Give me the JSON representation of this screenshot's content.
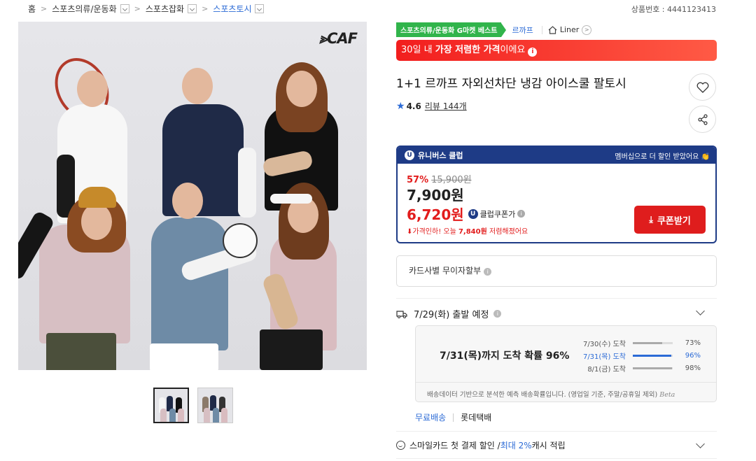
{
  "breadcrumb": {
    "home": "홈",
    "items": [
      "스포츠의류/운동화",
      "스포츠잡화",
      "스포츠토시"
    ]
  },
  "product_no": "상품번호 : 4441123413",
  "hero": {
    "logo_text": "CAF",
    "thumbnail_count": 2
  },
  "badges": {
    "best": "스포츠의류/운동화 G마켓 베스트",
    "brand": "르까프",
    "shop": "Liner"
  },
  "price_alert": {
    "pre": "30일 내 ",
    "bold": "가장 저렴한 가격",
    "post": "이에요"
  },
  "title": "1+1 르까프 자외선차단 냉감 아이스쿨 팔토시",
  "rating": {
    "score": "4.6",
    "reviews": "리뷰 144개"
  },
  "price_box": {
    "header": "유니버스 클럽",
    "header_right": "멤버십으로 더 할인 받았어요",
    "discount": "57%",
    "original": "15,900원",
    "price": "7,900원",
    "club_price": "6,720원",
    "club_label": "클럽쿠폰가",
    "drop_pre": "가격인하! 오늘 ",
    "drop_amount": "7,840원",
    "drop_post": " 저렴해졌어요",
    "coupon_button": "쿠폰받기"
  },
  "installment": "카드사별 무이자할부",
  "shipping": {
    "departure": "7/29(화) 출발 예정",
    "probability_text": "7/31(목)까지 도착 확률 96%",
    "rows": [
      {
        "date": "7/30(수) 도착",
        "pct": "73%",
        "value": 73
      },
      {
        "date": "7/31(목) 도착",
        "pct": "96%",
        "value": 96
      },
      {
        "date": "8/1(금) 도착",
        "pct": "98%",
        "value": 98
      }
    ],
    "note": "배송데이터 기반으로 분석한 예측 배송확률입니다. (영업일 기준, 주말/공휴일 제외)",
    "beta": "Beta",
    "free": "무료배송",
    "carrier": "롯데택배"
  },
  "smilecard": {
    "pre": "스마일카드 첫 결제 할인 / ",
    "highlight": "최대 2%",
    "post": " 캐시 적립"
  },
  "colors": {
    "accent_blue": "#2c6bd6",
    "club_navy": "#1e3b86",
    "price_red": "#e21c1c",
    "best_green": "#31b44b"
  }
}
